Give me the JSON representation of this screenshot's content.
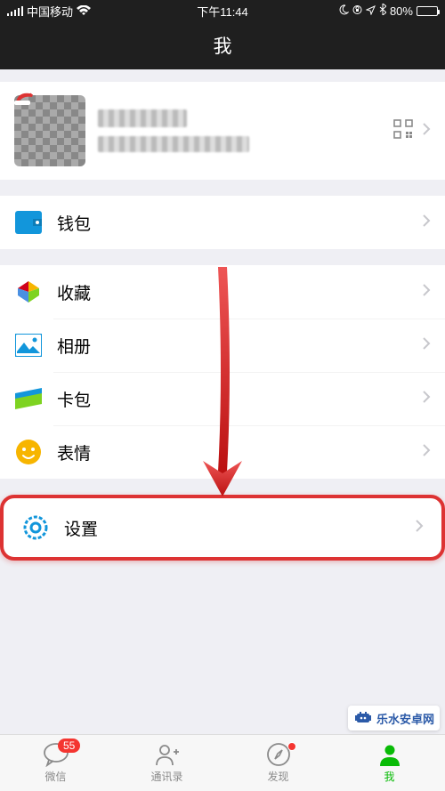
{
  "status": {
    "carrier": "中国移动",
    "time": "下午11:44",
    "battery_pct": "80%"
  },
  "nav": {
    "title": "我"
  },
  "menu": {
    "wallet": "钱包",
    "favorites": "收藏",
    "album": "相册",
    "cards": "卡包",
    "sticker": "表情",
    "settings": "设置"
  },
  "tabs": {
    "chats": {
      "label": "微信",
      "badge": "55"
    },
    "contacts": {
      "label": "通讯录"
    },
    "discover": {
      "label": "发现"
    },
    "me": {
      "label": "我"
    }
  },
  "watermark": {
    "text": "乐水安卓网"
  }
}
